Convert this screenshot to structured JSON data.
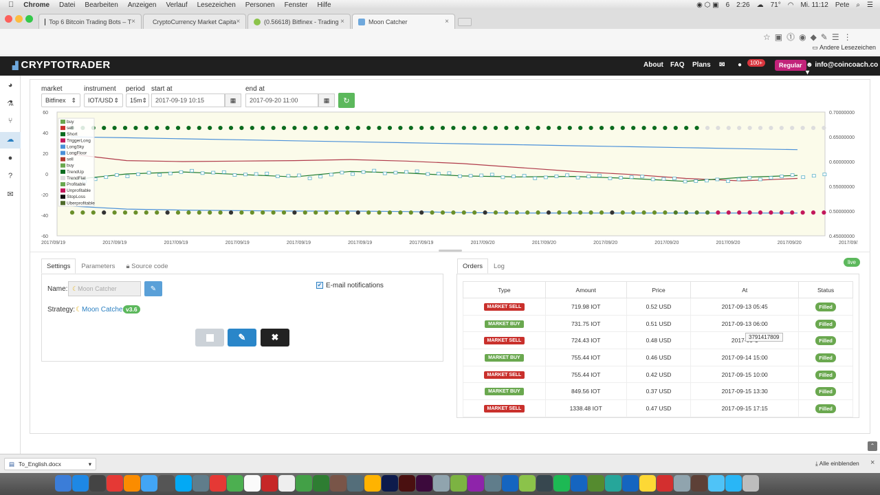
{
  "os_menubar": {
    "items": [
      "Chrome",
      "Datei",
      "Bearbeiten",
      "Anzeigen",
      "Verlauf",
      "Lesezeichen",
      "Personen",
      "Fenster",
      "Hilfe"
    ],
    "status": {
      "time_a": "2:26",
      "temp": "71°",
      "clock": "Mi. 11:12",
      "user": "Pete",
      "n6": "6"
    }
  },
  "browser": {
    "tabs": [
      {
        "label": "Top 6 Bitcoin Trading Bots – T",
        "color": "#222222"
      },
      {
        "label": "CryptoCurrency Market Capita",
        "color": "#d9b66a"
      },
      {
        "label": "(0.56618) Bitfinex - Trading",
        "color": "#8bc34a"
      },
      {
        "label": "Moon Catcher",
        "color": "#6fa8dc"
      }
    ],
    "bookmarks_label": "Andere Lesezeichen"
  },
  "navbar": {
    "brand": "CRYPTOTRADER",
    "links": [
      "About",
      "FAQ",
      "Plans"
    ],
    "messages_count": "100+",
    "plan": "Regular",
    "user": "info@coincoach.co"
  },
  "filters": {
    "market_label": "market",
    "market_value": "Bitfinex",
    "instrument_label": "instrument",
    "instrument_value": "IOT/USD",
    "period_label": "period",
    "period_value": "15m",
    "start_label": "start at",
    "start_value": "2017-09-19 10:15",
    "end_label": "end at",
    "end_value": "2017-09-20 11:00"
  },
  "chart_data": {
    "type": "line",
    "y_left_ticks": [
      "60",
      "40",
      "20",
      "0",
      "-20",
      "-40",
      "-60"
    ],
    "y_right_ticks": [
      "0.70000000",
      "0.65000000",
      "0.60000000",
      "0.55000000",
      "0.50000000",
      "0.45000000"
    ],
    "x_ticks": [
      "2017/09/19",
      "2017/09/19",
      "2017/09/19",
      "2017/09/19",
      "2017/09/19",
      "2017/09/19",
      "2017/09/19",
      "2017/09/20",
      "2017/09/20",
      "2017/09/20",
      "2017/09/20",
      "2017/09/20",
      "2017/09/20",
      "2017/09/20"
    ],
    "legend": [
      {
        "name": "buy",
        "color": "#6aa84f"
      },
      {
        "name": "sell",
        "color": "#c9302c"
      },
      {
        "name": "Short",
        "color": "#0b6b1e"
      },
      {
        "name": "TriggerLong",
        "color": "#c2185b"
      },
      {
        "name": "LongSky",
        "color": "#4a90d9"
      },
      {
        "name": "LongFloor",
        "color": "#4a90d9"
      },
      {
        "name": "sell",
        "color": "#b03a2e"
      },
      {
        "name": "buy",
        "color": "#6aa84f"
      },
      {
        "name": "TrendUp",
        "color": "#0b6b1e"
      },
      {
        "name": "TrendFlat",
        "color": "#dddddd"
      },
      {
        "name": "Profitable",
        "color": "#6aa84f"
      },
      {
        "name": "Unprofitable",
        "color": "#c2185b"
      },
      {
        "name": "StopLoss",
        "color": "#111111"
      },
      {
        "name": "Uberprofitable",
        "color": "#4f6b2a"
      }
    ],
    "series": [
      {
        "values": [
          0.65,
          0.648,
          0.646,
          0.644,
          0.642,
          0.64,
          0.638,
          0.636,
          0.634,
          0.632,
          0.63,
          0.628,
          0.626,
          0.624
        ]
      },
      {
        "values": [
          0.615,
          0.602,
          0.6,
          0.601,
          0.602,
          0.604,
          0.601,
          0.596,
          0.588,
          0.58,
          0.574,
          0.566,
          0.561,
          0.566
        ]
      },
      {
        "values": [
          0.563,
          0.575,
          0.579,
          0.574,
          0.569,
          0.58,
          0.577,
          0.571,
          0.569,
          0.57,
          0.566,
          0.56,
          0.568,
          0.572
        ]
      },
      {
        "values": [
          0.51,
          0.504,
          0.502,
          0.501,
          0.5,
          0.5,
          0.499,
          0.497,
          0.496,
          0.496,
          0.496,
          0.496,
          0.496,
          0.496
        ]
      }
    ]
  },
  "settings_panel": {
    "tabs": [
      "Settings",
      "Parameters",
      "Source code"
    ],
    "name_label": "Name:",
    "name_placeholder": "Moon Catcher",
    "email_label": "E-mail notifications",
    "strategy_label": "Strategy:",
    "strategy_name": "Moon Catcher",
    "version": "v3.6"
  },
  "orders_panel": {
    "tabs": [
      "Orders",
      "Log"
    ],
    "live": "live",
    "columns": [
      "Type",
      "Amount",
      "Price",
      "At",
      "Status"
    ],
    "rows": [
      {
        "type": "MARKET SELL",
        "amount": "719.98 IOT",
        "price": "0.52 USD",
        "at": "2017-09-13 05:45",
        "status": "Filled"
      },
      {
        "type": "MARKET BUY",
        "amount": "731.75 IOT",
        "price": "0.51 USD",
        "at": "2017-09-13 06:00",
        "status": "Filled"
      },
      {
        "type": "MARKET SELL",
        "amount": "724.43 IOT",
        "price": "0.48 USD",
        "at": "2017-09-1",
        "status": "Filled"
      },
      {
        "type": "MARKET BUY",
        "amount": "755.44 IOT",
        "price": "0.46 USD",
        "at": "2017-09-14 15:00",
        "status": "Filled"
      },
      {
        "type": "MARKET SELL",
        "amount": "755.44 IOT",
        "price": "0.42 USD",
        "at": "2017-09-15 10:00",
        "status": "Filled"
      },
      {
        "type": "MARKET BUY",
        "amount": "849.56 IOT",
        "price": "0.37 USD",
        "at": "2017-09-15 13:30",
        "status": "Filled"
      },
      {
        "type": "MARKET SELL",
        "amount": "1338.48 IOT",
        "price": "0.47 USD",
        "at": "2017-09-15 17:15",
        "status": "Filled"
      }
    ],
    "tooltip": "3791417809"
  },
  "download_bar": {
    "file": "To_English.docx",
    "show_all": "Alle einblenden"
  }
}
